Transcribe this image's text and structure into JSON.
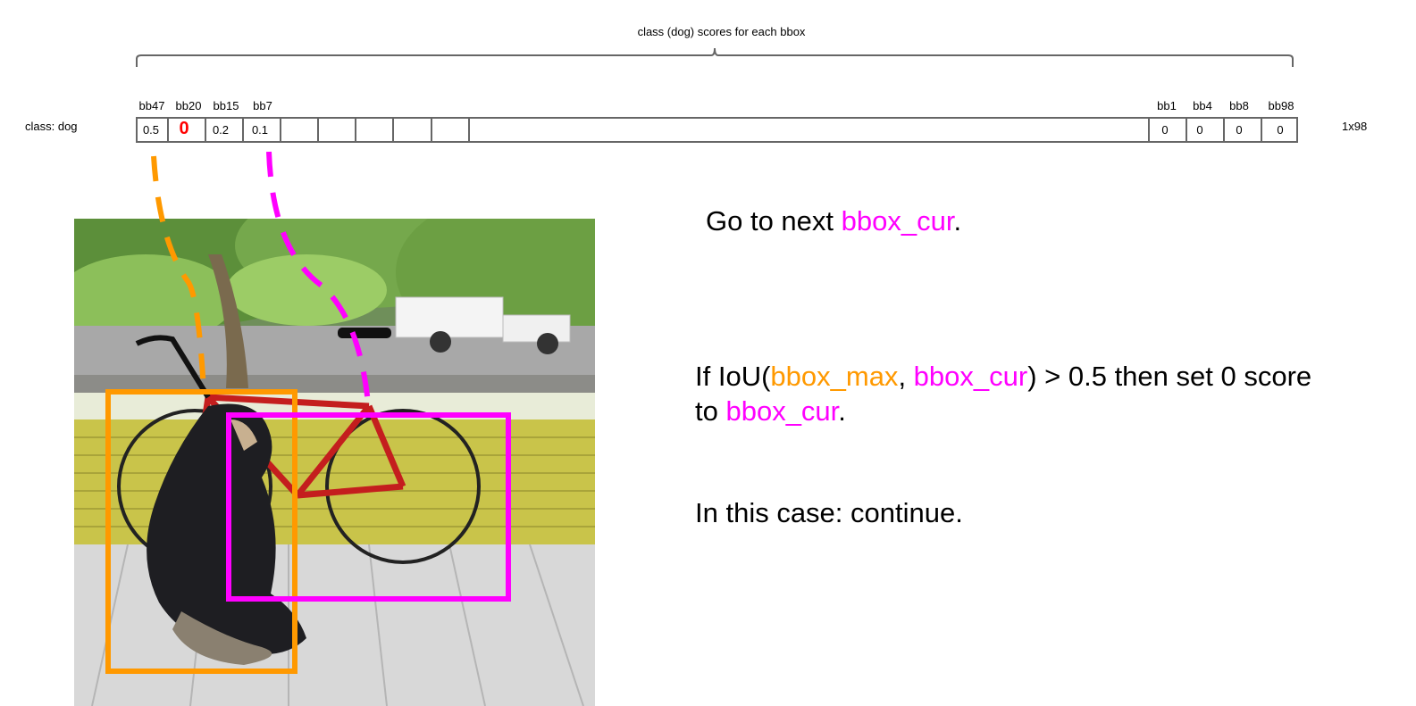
{
  "header": {
    "brace_title": "class (dog) scores for each bbox"
  },
  "row": {
    "label": "class: dog",
    "dims": "1x98",
    "left_boxes": [
      {
        "name": "bb47",
        "score": "0.5"
      },
      {
        "name": "bb20",
        "score": "0"
      },
      {
        "name": "bb15",
        "score": "0.2"
      },
      {
        "name": "bb7",
        "score": "0.1"
      }
    ],
    "right_boxes": [
      {
        "name": "bb1",
        "score": "0"
      },
      {
        "name": "bb4",
        "score": "0"
      },
      {
        "name": "bb8",
        "score": "0"
      },
      {
        "name": "bb98",
        "score": "0"
      }
    ]
  },
  "text": {
    "line1_prefix": "Go to next ",
    "line1_var": "bbox_cur",
    "line1_suffix": ".",
    "rule_prefix": "If IoU(",
    "rule_var_max": "bbox_max",
    "rule_comma": ", ",
    "rule_var_cur": "bbox_cur",
    "rule_mid": ") > 0.5 then set 0 score",
    "rule_line2_prefix": "to ",
    "rule_line2_var": "bbox_cur",
    "rule_line2_suffix": ".",
    "conclusion": "In this case: continue."
  },
  "colors": {
    "bbox_max": "#ff9900",
    "bbox_cur": "#ff00ff",
    "zeroed_score": "#ff0000"
  }
}
